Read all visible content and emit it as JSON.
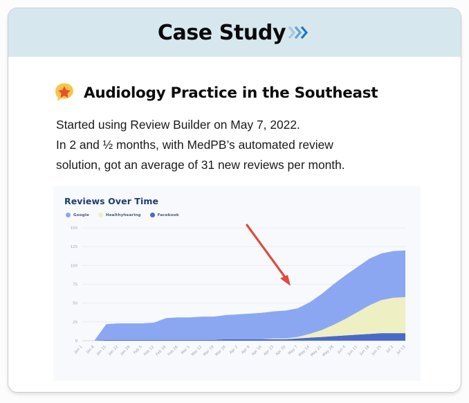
{
  "header": {
    "title": "Case Study",
    "chevron_icon": "double-chevron-right-icon",
    "background_color": "#d7e7ee"
  },
  "subhead": {
    "icon": "star-speech-bubble-icon",
    "text": "Audiology Practice in the Southeast"
  },
  "paragraph": {
    "line1": "Started using Review Builder on May 7, 2022.",
    "line2": "In 2 and ½ months, with MedPB’s automated review",
    "line3": "solution, got an average of  31 new reviews per month."
  },
  "chart_panel": {
    "title": "Reviews Over Time",
    "annotation_icon": "red-arrow-annotation",
    "legend": [
      {
        "label": "Google",
        "color": "#8ca7f2"
      },
      {
        "label": "Healthyhearing",
        "color": "#eeefc2"
      },
      {
        "label": "Facebook",
        "color": "#4a69c8"
      }
    ]
  },
  "chart_data": {
    "type": "area",
    "title": "Reviews Over Time",
    "xlabel": "",
    "ylabel": "",
    "ylim": [
      0,
      150
    ],
    "yticks": [
      0,
      25,
      50,
      75,
      100,
      125,
      150
    ],
    "grid": true,
    "stacked": true,
    "legend_position": "top-left",
    "categories": [
      "Jan 1",
      "Jan 8",
      "Jan 15",
      "Jan 22",
      "Jan 29",
      "Feb 5",
      "Feb 12",
      "Feb 19",
      "Feb 26",
      "Mar 5",
      "Mar 12",
      "Mar 19",
      "Mar 26",
      "Apr 2",
      "Apr 9",
      "Apr 16",
      "Apr 23",
      "Apr 30",
      "May 7",
      "May 14",
      "May 21",
      "May 28",
      "Jun 4",
      "Jun 11",
      "Jun 18",
      "Jun 25",
      "Jul 2",
      "Jul 13"
    ],
    "series": [
      {
        "name": "Facebook",
        "color": "#4a69c8",
        "values": [
          0,
          0,
          1,
          1,
          1,
          1,
          1,
          1,
          1,
          1,
          1,
          1,
          2,
          2,
          2,
          2,
          2,
          2,
          3,
          4,
          5,
          6,
          7,
          8,
          9,
          10,
          10,
          10
        ]
      },
      {
        "name": "Healthyhearing",
        "color": "#eeefc2",
        "values": [
          0,
          0,
          0,
          0,
          0,
          0,
          0,
          0,
          0,
          0,
          0,
          0,
          0,
          0,
          0,
          0,
          1,
          1,
          2,
          5,
          9,
          15,
          22,
          30,
          38,
          44,
          47,
          48
        ]
      },
      {
        "name": "Google",
        "color": "#8ca7f2",
        "values": [
          0,
          0,
          21,
          22,
          22,
          22,
          23,
          29,
          30,
          30,
          31,
          31,
          32,
          33,
          34,
          35,
          36,
          37,
          38,
          42,
          48,
          54,
          58,
          60,
          62,
          62,
          62,
          62
        ]
      }
    ],
    "stacked_totals": [
      0,
      0,
      22,
      23,
      23,
      23,
      24,
      30,
      31,
      31,
      32,
      32,
      34,
      35,
      36,
      37,
      39,
      40,
      43,
      51,
      62,
      75,
      87,
      98,
      109,
      116,
      119,
      120
    ]
  }
}
